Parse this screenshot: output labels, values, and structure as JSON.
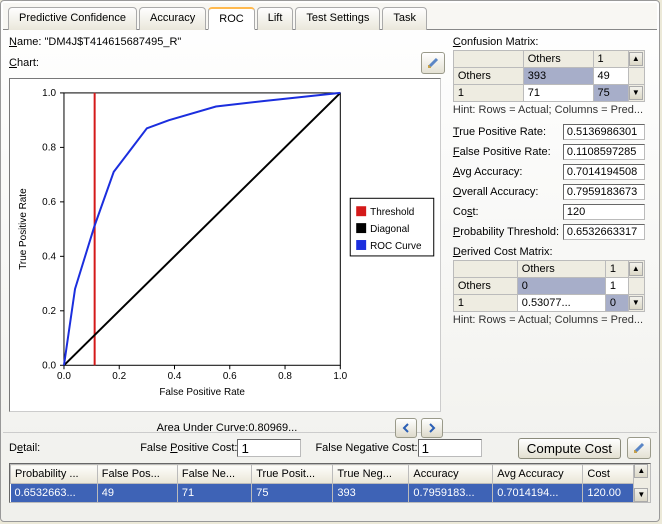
{
  "tabs": [
    "Predictive Confidence",
    "Accuracy",
    "ROC",
    "Lift",
    "Test Settings",
    "Task"
  ],
  "active_tab": 2,
  "name_label": "Name:",
  "name_value": "\"DM4J$T414615687495_R\"",
  "chart_label": "Chart:",
  "auc_label": "Area Under Curve:0.80969...",
  "confusion": {
    "title": "Confusion Matrix:",
    "col_headers": [
      "",
      "Others",
      "1"
    ],
    "rows": [
      {
        "header": "Others",
        "cells": [
          "393",
          "49"
        ]
      },
      {
        "header": "1",
        "cells": [
          "71",
          "75"
        ]
      }
    ],
    "hint": "Hint: Rows = Actual; Columns = Pred..."
  },
  "stats": {
    "tpr": {
      "label": "True Positive Rate:",
      "value": "0.5136986301"
    },
    "fpr": {
      "label": "False Positive Rate:",
      "value": "0.1108597285"
    },
    "avg": {
      "label": "Avg Accuracy:",
      "value": "0.7014194508"
    },
    "overall": {
      "label": "Overall Accuracy:",
      "value": "0.7959183673"
    },
    "cost": {
      "label": "Cost:",
      "value": "120"
    },
    "pthresh": {
      "label": "Probability Threshold:",
      "value": "0.6532663317"
    }
  },
  "derived": {
    "title": "Derived Cost Matrix:",
    "col_headers": [
      "",
      "Others",
      "1"
    ],
    "rows": [
      {
        "header": "Others",
        "cells": [
          "0",
          "1"
        ]
      },
      {
        "header": "1",
        "cells": [
          "0.53077...",
          "0"
        ]
      }
    ],
    "hint": "Hint: Rows = Actual; Columns = Pred..."
  },
  "detail_label": "Detail:",
  "fp_cost_label": "False Positive Cost:",
  "fp_cost_value": "1",
  "fn_cost_label": "False Negative Cost:",
  "fn_cost_value": "1",
  "compute_label": "Compute Cost",
  "grid": {
    "headers": [
      "Probability ...",
      "False Pos...",
      "False Ne...",
      "True Posit...",
      "True Neg...",
      "Accuracy",
      "Avg Accuracy",
      "Cost"
    ],
    "row": [
      "0.6532663...",
      "49",
      "71",
      "75",
      "393",
      "0.7959183...",
      "0.7014194...",
      "120.00"
    ]
  },
  "chart_data": {
    "type": "line",
    "title": "",
    "xlabel": "False Positive Rate",
    "ylabel": "True Positive Rate",
    "xlim": [
      0.0,
      1.0
    ],
    "ylim": [
      0.0,
      1.0
    ],
    "xticks": [
      0.0,
      0.2,
      0.4,
      0.6,
      0.8,
      1.0
    ],
    "yticks": [
      0.0,
      0.2,
      0.4,
      0.6,
      0.8,
      1.0
    ],
    "threshold_x": 0.111,
    "series": [
      {
        "name": "Threshold",
        "color": "#d41919",
        "type": "vline",
        "x": 0.111
      },
      {
        "name": "Diagonal",
        "color": "#000000",
        "points": [
          [
            0,
            0
          ],
          [
            1,
            1
          ]
        ]
      },
      {
        "name": "ROC Curve",
        "color": "#1b2ede",
        "points": [
          [
            0.0,
            0.0
          ],
          [
            0.04,
            0.28
          ],
          [
            0.11,
            0.51
          ],
          [
            0.18,
            0.71
          ],
          [
            0.3,
            0.87
          ],
          [
            0.38,
            0.9
          ],
          [
            0.55,
            0.95
          ],
          [
            0.72,
            0.97
          ],
          [
            1.0,
            1.0
          ]
        ]
      }
    ],
    "legend": [
      "Threshold",
      "Diagonal",
      "ROC Curve"
    ]
  }
}
